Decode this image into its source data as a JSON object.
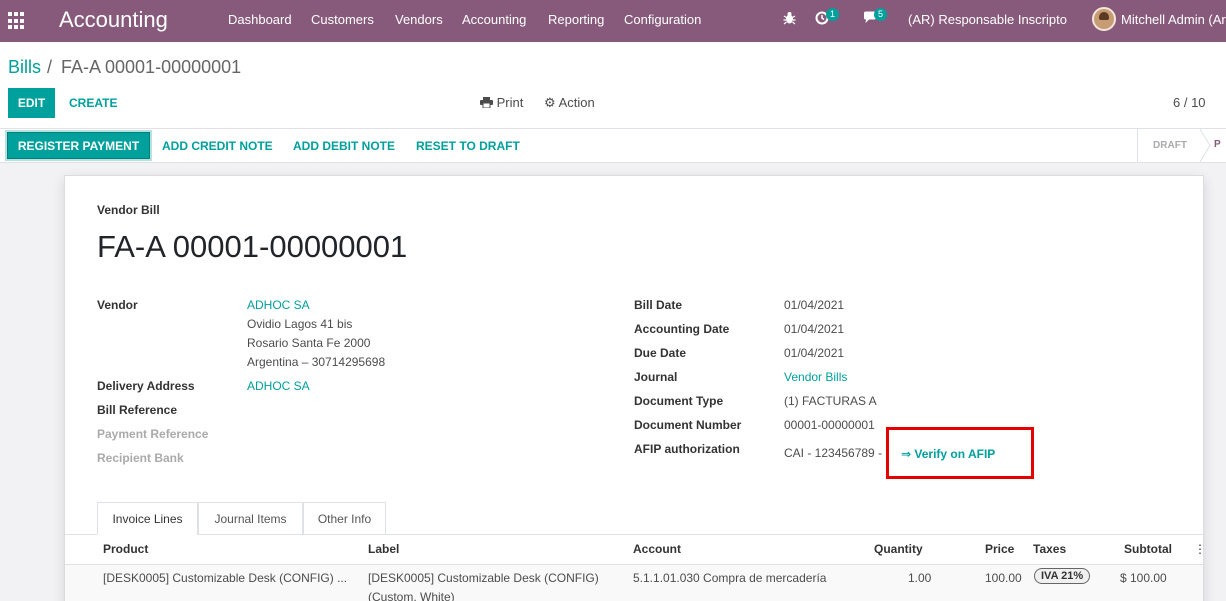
{
  "navbar": {
    "brand": "Accounting",
    "menu": [
      "Dashboard",
      "Customers",
      "Vendors",
      "Accounting",
      "Reporting",
      "Configuration"
    ],
    "activities_count": "1",
    "messages_count": "5",
    "company": "(AR) Responsable Inscripto",
    "user": "Mitchell Admin (Ar"
  },
  "breadcrumb": {
    "parent": "Bills",
    "separator": "/",
    "current": "FA-A 00001-00000001"
  },
  "toolbar": {
    "edit": "EDIT",
    "create": "CREATE",
    "print": "Print",
    "action": "Action",
    "pager": "6 / 10"
  },
  "statusbar": {
    "register_payment": "REGISTER PAYMENT",
    "add_credit_note": "ADD CREDIT NOTE",
    "add_debit_note": "ADD DEBIT NOTE",
    "reset_to_draft": "RESET TO DRAFT",
    "stage_draft": "DRAFT",
    "stage_posted": "P"
  },
  "form": {
    "subtitle": "Vendor Bill",
    "title": "FA-A 00001-00000001",
    "left": {
      "vendor_label": "Vendor",
      "vendor_name": "ADHOC SA",
      "vendor_address": [
        "Ovidio Lagos 41 bis",
        "Rosario Santa Fe 2000",
        "Argentina – 30714295698"
      ],
      "delivery_address_label": "Delivery Address",
      "delivery_address_value": "ADHOC SA",
      "bill_reference_label": "Bill Reference",
      "payment_reference_label": "Payment Reference",
      "recipient_bank_label": "Recipient Bank"
    },
    "right": {
      "bill_date_label": "Bill Date",
      "bill_date": "01/04/2021",
      "accounting_date_label": "Accounting Date",
      "accounting_date": "01/04/2021",
      "due_date_label": "Due Date",
      "due_date": "01/04/2021",
      "journal_label": "Journal",
      "journal": "Vendor Bills",
      "document_type_label": "Document Type",
      "document_type": "(1) FACTURAS A",
      "document_number_label": "Document Number",
      "document_number": "00001-00000001",
      "afip_label": "AFIP authorization",
      "afip_value": "CAI - 123456789 -",
      "verify_link": "⇒ Verify on AFIP"
    }
  },
  "tabs": [
    "Invoice Lines",
    "Journal Items",
    "Other Info"
  ],
  "table": {
    "headers": {
      "product": "Product",
      "label": "Label",
      "account": "Account",
      "quantity": "Quantity",
      "price": "Price",
      "taxes": "Taxes",
      "subtotal": "Subtotal"
    },
    "rows": [
      {
        "product": "[DESK0005] Customizable Desk (CONFIG) ...",
        "label_line1": "[DESK0005] Customizable Desk (CONFIG)",
        "label_line2": "(Custom, White)",
        "account": "5.1.1.01.030 Compra de mercadería",
        "quantity": "1.00",
        "price": "100.00",
        "tax": "IVA 21%",
        "subtotal": "$ 100.00"
      }
    ]
  },
  "colors": {
    "navbar": "#875a7b",
    "primary": "#00a09d",
    "highlight_box": "#e60000"
  }
}
